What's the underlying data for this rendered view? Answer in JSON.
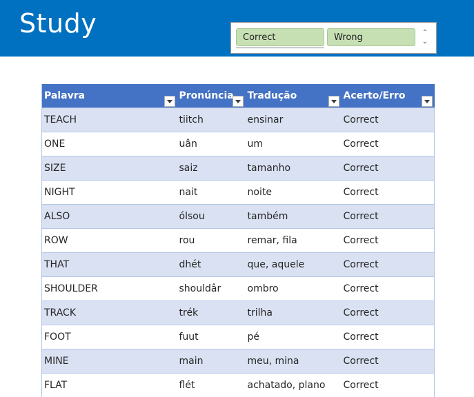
{
  "header": {
    "title": "Study",
    "background": "#0070c0"
  },
  "slicer": {
    "items": [
      "Correct",
      "Wrong"
    ],
    "selected_color": "#c6e0b4",
    "scroll_up_icon": "chevron-up-icon",
    "scroll_down_icon": "chevron-down-icon"
  },
  "table": {
    "columns": [
      "Palavra",
      "Pronúncia",
      "Tradução",
      "Acerto/Erro"
    ],
    "rows": [
      [
        "TEACH",
        "tiitch",
        "ensinar",
        "Correct"
      ],
      [
        "ONE",
        "uân",
        "um",
        "Correct"
      ],
      [
        "SIZE",
        "saiz",
        "tamanho",
        "Correct"
      ],
      [
        "NIGHT",
        "nait",
        "noite",
        "Correct"
      ],
      [
        "ALSO",
        "ólsou",
        "também",
        "Correct"
      ],
      [
        "ROW",
        "rou",
        "remar, fila",
        "Correct"
      ],
      [
        "THAT",
        "dhét",
        "que, aquele",
        "Correct"
      ],
      [
        "SHOULDER",
        "shouldâr",
        "ombro",
        "Correct"
      ],
      [
        "TRACK",
        "trék",
        "trilha",
        "Correct"
      ],
      [
        "FOOT",
        "fuut",
        "pé",
        "Correct"
      ],
      [
        "MINE",
        "main",
        "meu, mina",
        "Correct"
      ],
      [
        "FLAT",
        "flét",
        "achatado, plano",
        "Correct"
      ]
    ],
    "header_color": "#4472c4",
    "band_color": "#d9e1f2"
  }
}
